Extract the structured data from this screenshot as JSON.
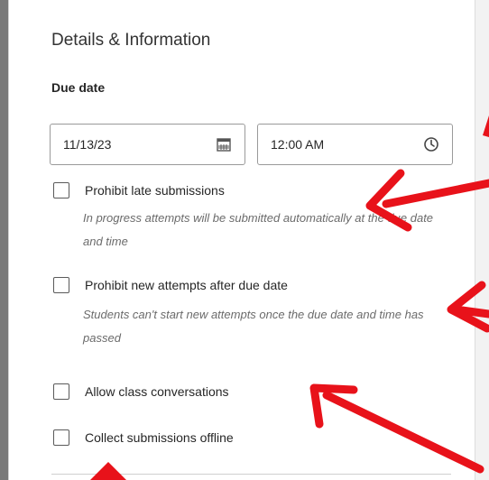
{
  "panel": {
    "title": "Details & Information",
    "due_date_label": "Due date",
    "date_value": "11/13/23",
    "time_value": "12:00 AM",
    "options": [
      {
        "label": "Prohibit late submissions",
        "checked": false,
        "help": "In progress attempts will be submitted automatically at the due date and time"
      },
      {
        "label": "Prohibit new attempts after due date",
        "checked": false,
        "help": "Students can't start new attempts once the due date and time has passed"
      },
      {
        "label": "Allow class conversations",
        "checked": false
      },
      {
        "label": "Collect submissions offline",
        "checked": false
      }
    ]
  },
  "icons": {
    "date": "calendar-icon",
    "time": "clock-icon"
  },
  "colors": {
    "annotation_arrow": "#e8121a",
    "checkbox_border": "#5a5a5a",
    "help_text": "#6b6b6b"
  }
}
